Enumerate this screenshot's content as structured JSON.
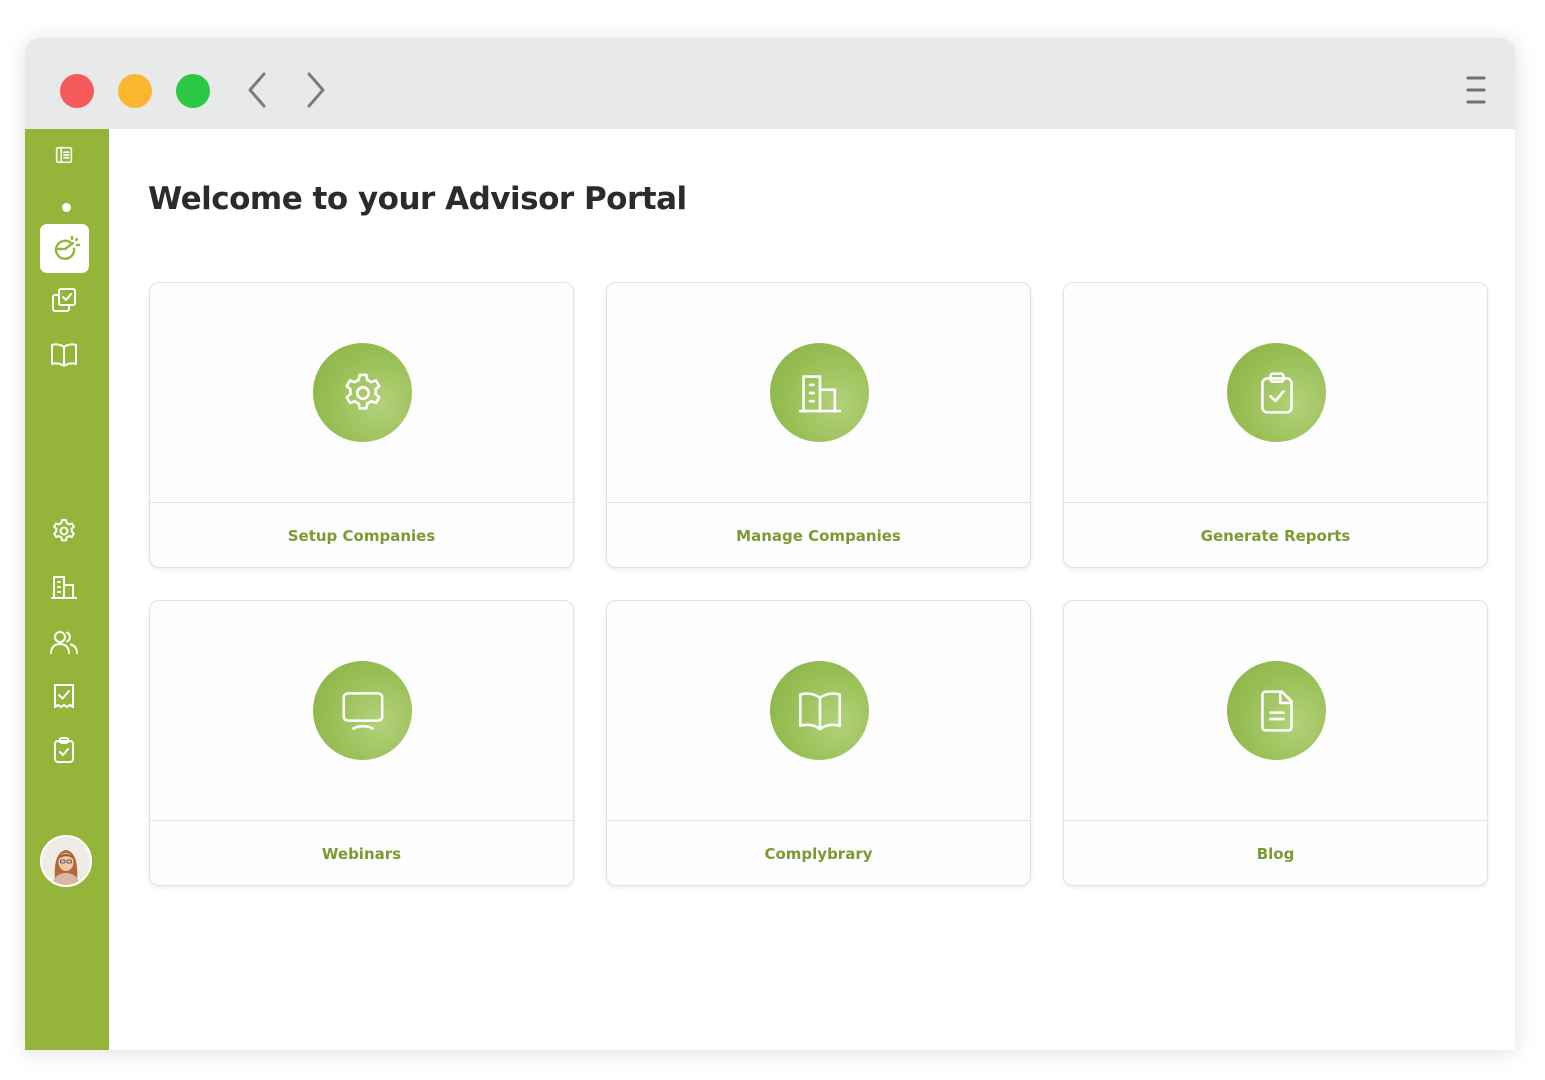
{
  "colors": {
    "sidebar": "#94b53a",
    "accent_text": "#7b9a32",
    "icon_circle": "#98bf55",
    "close_dot": "#f55a5a",
    "minimize_dot": "#fbb62f",
    "maximize_dot": "#2bc846"
  },
  "browser": {
    "icons": [
      "close-dot",
      "minimize-dot",
      "maximize-dot",
      "back-arrow-icon",
      "forward-arrow-icon",
      "hamburger-menu-icon"
    ]
  },
  "sidebar": {
    "items": [
      {
        "icon": "book-pages-icon"
      },
      {
        "icon": "dashboard-speed-icon",
        "active": true
      },
      {
        "icon": "copy-check-icon"
      },
      {
        "icon": "open-book-icon"
      },
      {
        "icon": "gear-icon"
      },
      {
        "icon": "building-icon"
      },
      {
        "icon": "users-icon"
      },
      {
        "icon": "receipt-check-icon"
      },
      {
        "icon": "clipboard-check-icon"
      }
    ],
    "avatar": "user-avatar"
  },
  "main": {
    "title": "Welcome to your Advisor Portal",
    "cards": [
      {
        "label": "Setup Companies",
        "icon": "gear-icon"
      },
      {
        "label": "Manage Companies",
        "icon": "building-icon"
      },
      {
        "label": "Generate Reports",
        "icon": "clipboard-check-icon"
      },
      {
        "label": "Webinars",
        "icon": "monitor-icon"
      },
      {
        "label": "Complybrary",
        "icon": "open-book-icon"
      },
      {
        "label": "Blog",
        "icon": "document-icon"
      }
    ]
  }
}
